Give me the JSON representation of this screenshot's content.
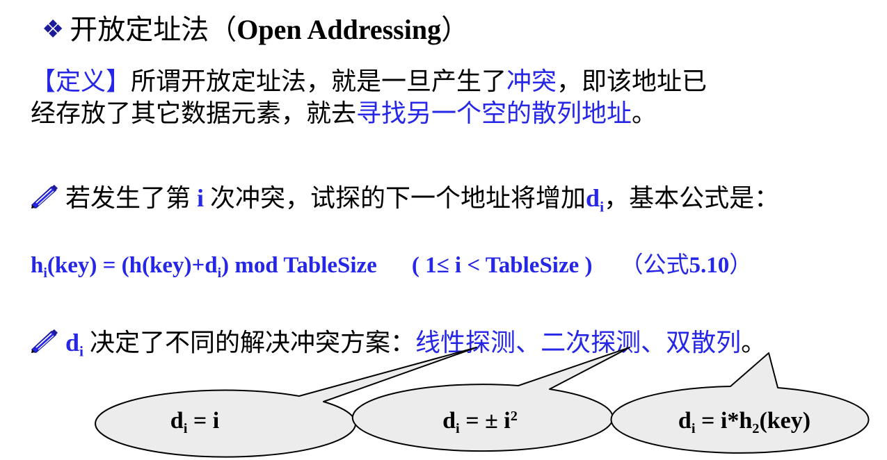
{
  "title": {
    "cn": "开放定址法（",
    "en": "Open Addressing",
    "close": "）"
  },
  "definition": {
    "tag": "【定义】",
    "line1_a": "所谓开放定址法，就是一旦产生了",
    "line1_hl": "冲突",
    "line1_b": "，即该地址已",
    "line2_a": "经存放了其它数据元素，就去",
    "line2_hl": "寻找另一个空的散列地址",
    "line2_b": "。"
  },
  "probe": {
    "a": "若发生了第",
    "i": "i",
    "b": "次冲突，试探的下一个地址将增加",
    "d": "d",
    "sub": "i",
    "c": "，基本公式是："
  },
  "formula": {
    "h": "h",
    "h_sub": "i",
    "mid1": "(key) = (h(key)+d",
    "d_sub": "i",
    "mid2": ") mod TableSize",
    "range": "( 1≤ i < TableSize )",
    "note_open": "（公式",
    "note_num": "5.10",
    "note_close": "）"
  },
  "schemes": {
    "d": "d",
    "sub": "i",
    "intro": "决定了不同的解决冲突方案：",
    "s1": "线性探测",
    "sep1": "、",
    "s2": "二次探测",
    "sep2": "、",
    "s3": "双散列",
    "end": "。"
  },
  "bubbles": [
    {
      "d": "d",
      "sub": "i",
      "rest": " = i"
    },
    {
      "d": "d",
      "sub": "i",
      "rest": " = ± i",
      "sup": "2"
    },
    {
      "d": "d",
      "sub": "i",
      "rest": " = i*h",
      "sub2": "2",
      "tail": "(key)"
    }
  ],
  "colors": {
    "highlight": "#2626e6",
    "diamond": "#1c1c9a",
    "bubble_fill": "#ececec"
  }
}
